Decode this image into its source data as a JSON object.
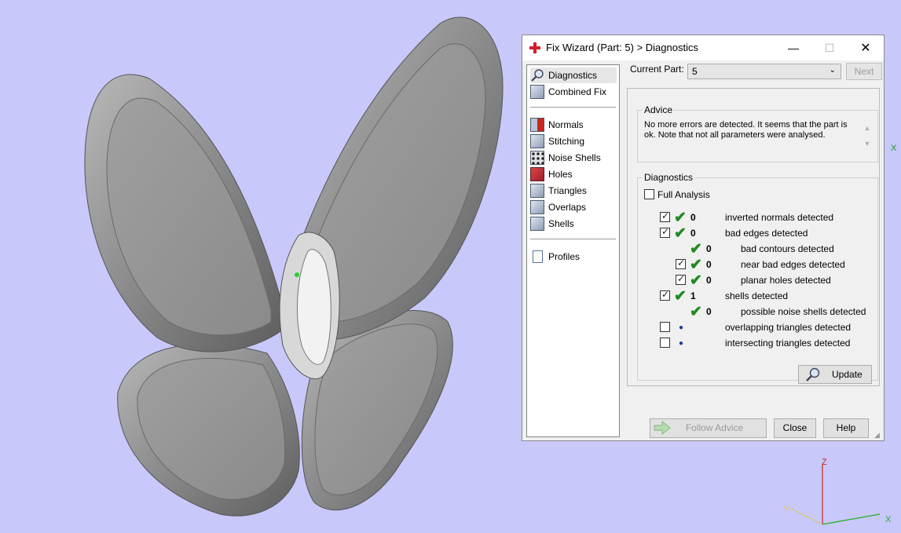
{
  "window": {
    "title": "Fix Wizard (Part: 5) > Diagnostics",
    "min_glyph": "—",
    "max_glyph": "☐",
    "close_glyph": "✕"
  },
  "viewport": {
    "background": "#c8c8fa",
    "axes": {
      "z": "Z",
      "x": "X",
      "y": "Y",
      "edge_x": "X"
    }
  },
  "nav": {
    "items": [
      {
        "label": "Diagnostics",
        "icon": "magnifier-icon"
      },
      {
        "label": "Combined Fix",
        "icon": "box-icon"
      },
      {
        "label": "Normals",
        "icon": "normals-icon"
      },
      {
        "label": "Stitching",
        "icon": "stitching-icon"
      },
      {
        "label": "Noise Shells",
        "icon": "noise-shells-icon"
      },
      {
        "label": "Holes",
        "icon": "holes-icon"
      },
      {
        "label": "Triangles",
        "icon": "triangles-icon"
      },
      {
        "label": "Overlaps",
        "icon": "overlaps-icon"
      },
      {
        "label": "Shells",
        "icon": "shells-icon"
      },
      {
        "label": "Profiles",
        "icon": "document-icon"
      }
    ],
    "selected": "Diagnostics"
  },
  "current_part": {
    "label": "Current Part:",
    "value": "5",
    "next_label": "Next"
  },
  "advice": {
    "legend": "Advice",
    "text": "No more errors are detected. It seems that the part is ok. Note that not all parameters were analysed."
  },
  "diagnostics": {
    "legend": "Diagnostics",
    "full_analysis_label": "Full Analysis",
    "full_analysis_checked": false,
    "rows": [
      {
        "checkbox": true,
        "checked": true,
        "status": "ok",
        "count": "0",
        "label": "inverted normals detected",
        "indent": 0
      },
      {
        "checkbox": true,
        "checked": true,
        "status": "ok",
        "count": "0",
        "label": "bad edges detected",
        "indent": 0
      },
      {
        "checkbox": false,
        "checked": false,
        "status": "ok",
        "count": "0",
        "label": "bad contours detected",
        "indent": 1
      },
      {
        "checkbox": true,
        "checked": true,
        "status": "ok",
        "count": "0",
        "label": "near bad edges detected",
        "indent": 1
      },
      {
        "checkbox": true,
        "checked": true,
        "status": "ok",
        "count": "0",
        "label": "planar holes detected",
        "indent": 1
      },
      {
        "checkbox": true,
        "checked": true,
        "status": "ok",
        "count": "1",
        "label": "shells detected",
        "indent": 0
      },
      {
        "checkbox": false,
        "checked": false,
        "status": "ok",
        "count": "0",
        "label": "possible noise shells detected",
        "indent": 1
      },
      {
        "checkbox": true,
        "checked": false,
        "status": "pending",
        "count": "",
        "label": "overlapping triangles detected",
        "indent": 0
      },
      {
        "checkbox": true,
        "checked": false,
        "status": "pending",
        "count": "",
        "label": "intersecting triangles detected",
        "indent": 0
      }
    ],
    "update_label": "Update"
  },
  "buttons": {
    "follow_advice": "Follow Advice",
    "close": "Close",
    "help": "Help"
  }
}
